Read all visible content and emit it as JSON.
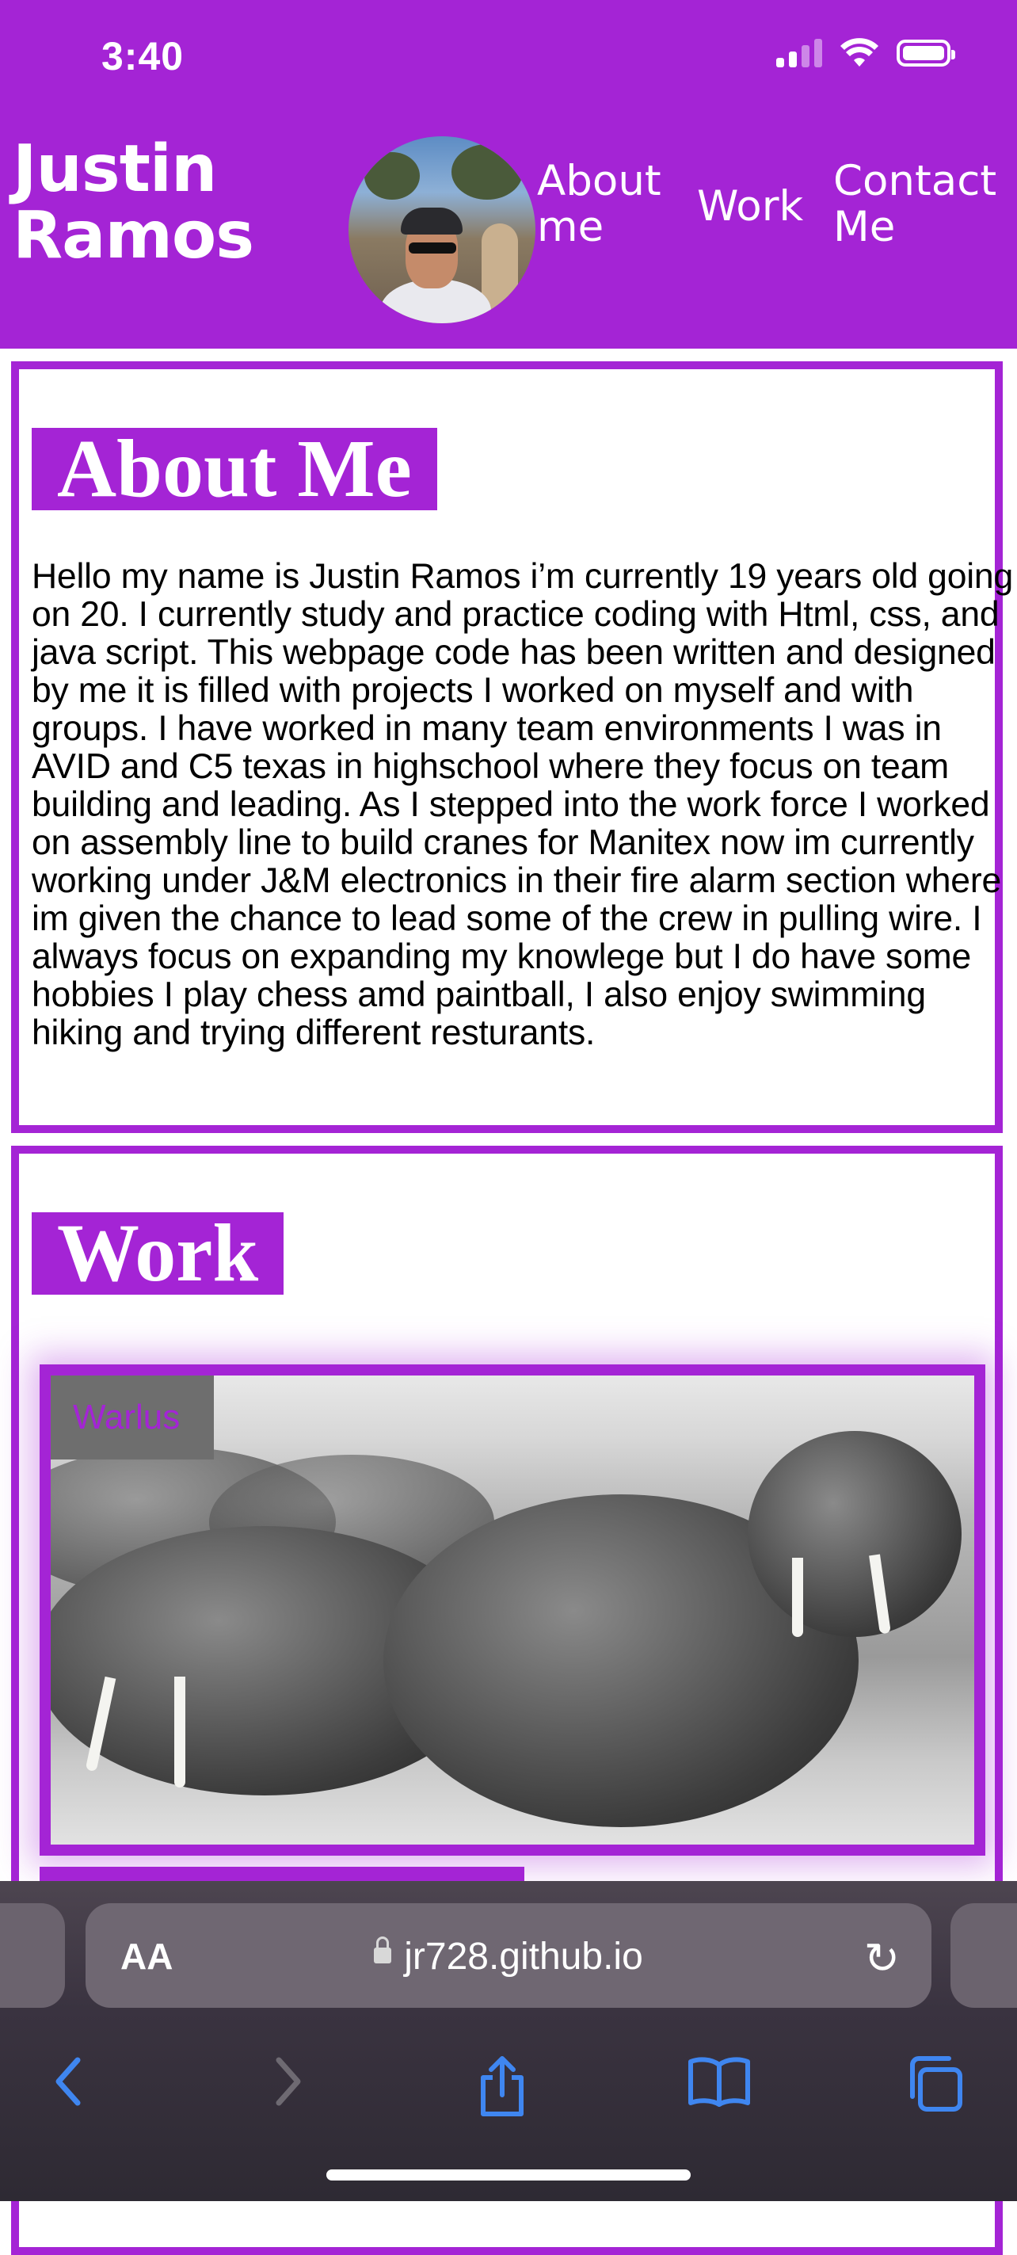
{
  "status_bar": {
    "time": "3:40",
    "icons": [
      "signal-icon",
      "wifi-icon",
      "battery-icon"
    ]
  },
  "header": {
    "site_name_line1": "Justin",
    "site_name_line2": "Ramos",
    "nav": [
      {
        "label": "About me"
      },
      {
        "label": "Work"
      },
      {
        "label": "Contact Me"
      }
    ]
  },
  "about": {
    "title": "About Me",
    "body": "Hello my name is Justin Ramos i’m currently 19 years old going on 20. I currently study and practice coding with Html, css, and java script. This webpage code has been written and designed by me it is filled with projects I worked on myself and with groups. I have worked in many team environments I was in AVID and C5 texas in highschool where they focus on team building and leading. As I stepped into the work force I worked on assembly line to build cranes for Manitex now im currently working under J&M electronics in their fire alarm section where im given the chance to lead some of the crew in pulling wire. I always focus on expanding my knowlege but I do have some hobbies I play chess amd paintball, I also enjoy swimming hiking and trying different resturants."
  },
  "work": {
    "title": "Work",
    "projects": [
      {
        "label": "Warlus"
      }
    ]
  },
  "browser": {
    "text_size_label": "AA",
    "url": "jr728.github.io",
    "toolbar": [
      "back-icon",
      "forward-icon",
      "share-icon",
      "bookmarks-icon",
      "tabs-icon"
    ]
  },
  "colors": {
    "accent": "#a424d5",
    "browser_accent": "#3f86f0"
  }
}
